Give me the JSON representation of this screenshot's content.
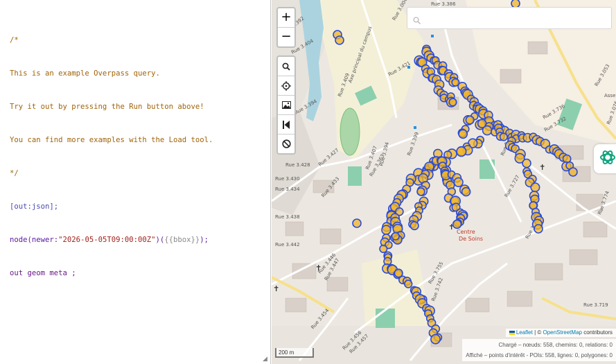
{
  "editor": {
    "comment_open": "/*",
    "comment_line1": "This is an example Overpass query.",
    "comment_line2": "Try it out by pressing the Run button above!",
    "comment_line3": "You can find more examples with the Load tool.",
    "comment_close": "*/",
    "setting_line": "[out:json];",
    "node_prefix": "node(newer:",
    "node_date": "\"2026-05-05T09:00:00Z\"",
    "node_open": ")(",
    "node_bbox": "{{bbox}}",
    "node_close": ");",
    "out_line": "out geom meta ;"
  },
  "map": {
    "zoom_in_label": "+",
    "zoom_out_label": "−",
    "tools": [
      "search-icon",
      "target-icon",
      "image-icon",
      "skip-back-icon",
      "block-icon"
    ],
    "search_placeholder": "",
    "scale_label": "200 m",
    "attribution": {
      "leaflet": "Leaflet",
      "separator": " | © ",
      "osm": "OpenStreetMap",
      "contributors": " contributors"
    },
    "stats_line1": "Chargé – nœuds: 558, chemins: 0, relations: 0",
    "stats_line2": "Affiché – points d'intérêt - POIs: 558, lignes: 0, polygones: 0",
    "road_labels": [
      "Rue 3.394",
      "Rue 3.404",
      "Rue 3.409",
      "Rue 3.421",
      "Rue 3.392",
      "Rue 3.428",
      "Rue 3.430",
      "Rue 3.434",
      "Rue 3.438",
      "Rue 3.442",
      "Rue 3.446",
      "Rue 3.447",
      "Rue 3.454",
      "Rue 3.456",
      "Rue 3.457",
      "Rue 3.427",
      "Rue 3.433",
      "Rue 3.407",
      "Rue 3.363",
      "Rue 3.394",
      "Rue 3.399",
      "Rue 3.717",
      "Rue 3.727",
      "Rue 3.722",
      "Rue 3.732",
      "Rue 3.736",
      "Rue 3.742",
      "Rue 3.755",
      "Rue 3.719",
      "Rue 3.053",
      "Rue 3.774",
      "Rue 3.076",
      "Rue 3.386",
      "Rue 3.004",
      "Axe principal du campus",
      "Assem Noti"
    ],
    "poi_label_1": "Centre",
    "poi_label_2": "De Soins",
    "accent_color": "#2a4bd7",
    "marker_fill": "#f0b429"
  }
}
